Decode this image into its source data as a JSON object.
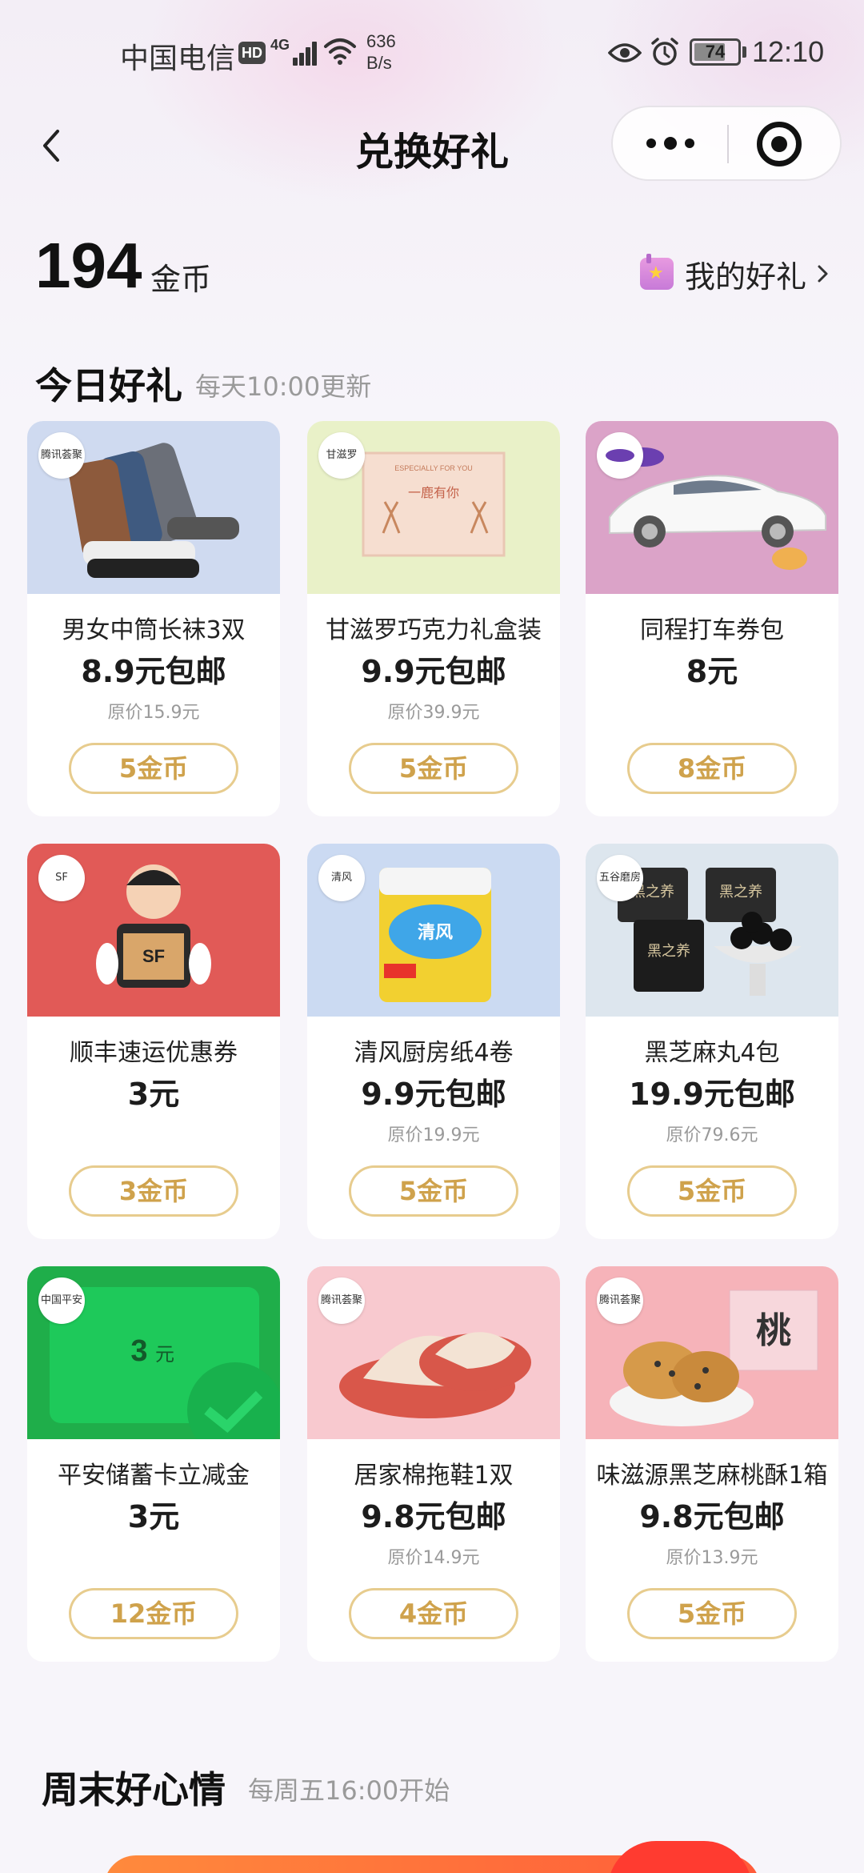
{
  "status_bar": {
    "carrier": "中国电信",
    "hd": "HD",
    "network": "4G",
    "speed_value": "636",
    "speed_unit": "B/s",
    "battery": "74",
    "time": "12:10"
  },
  "nav": {
    "title": "兑换好礼"
  },
  "coins": {
    "amount": "194",
    "unit": "金币",
    "my_gifts_label": "我的好礼"
  },
  "today": {
    "title": "今日好礼",
    "subtitle": "每天10:00更新"
  },
  "gifts": [
    {
      "logo": "腾讯荟聚",
      "name": "男女中筒长袜3双",
      "price": "8.9元包邮",
      "original": "原价15.9元",
      "cost": "5金币",
      "img_color": "#cfdaf0"
    },
    {
      "logo": "甘滋罗",
      "name": "甘滋罗巧克力礼盒装",
      "price": "9.9元包邮",
      "original": "原价39.9元",
      "cost": "5金币",
      "img_color": "#e9f1c8"
    },
    {
      "logo": "",
      "name": "同程打车券包",
      "price": "8元",
      "original": "",
      "cost": "8金币",
      "img_color": "#dba3c8"
    },
    {
      "logo": "SF",
      "name": "顺丰速运优惠券",
      "price": "3元",
      "original": "",
      "cost": "3金币",
      "img_color": "#e15a57"
    },
    {
      "logo": "清风",
      "name": "清风厨房纸4卷",
      "price": "9.9元包邮",
      "original": "原价19.9元",
      "cost": "5金币",
      "img_color": "#cbdaf2"
    },
    {
      "logo": "五谷磨房",
      "name": "黑芝麻丸4包",
      "price": "19.9元包邮",
      "original": "原价79.6元",
      "cost": "5金币",
      "img_color": "#dde6ee"
    },
    {
      "logo": "中国平安",
      "name": "平安储蓄卡立减金",
      "price": "3元",
      "original": "",
      "cost": "12金币",
      "img_color": "#1fae4a"
    },
    {
      "logo": "腾讯荟聚",
      "name": "居家棉拖鞋1双",
      "price": "9.8元包邮",
      "original": "原价14.9元",
      "cost": "4金币",
      "img_color": "#f8c9cf"
    },
    {
      "logo": "腾讯荟聚",
      "name": "味滋源黑芝麻桃酥1箱",
      "price": "9.8元包邮",
      "original": "原价13.9元",
      "cost": "5金币",
      "img_color": "#f6b3b9"
    }
  ],
  "gift_images": {
    "socks_text": "",
    "choco_top": "ESPECIALLY FOR YOU",
    "choco_main": "一鹿有你",
    "card_amount": "3",
    "card_unit": "元",
    "sesame_label": "黑之养",
    "cake_label": "桃"
  },
  "weekend": {
    "title": "周末好心情",
    "subtitle": "每周五16:00开始"
  }
}
